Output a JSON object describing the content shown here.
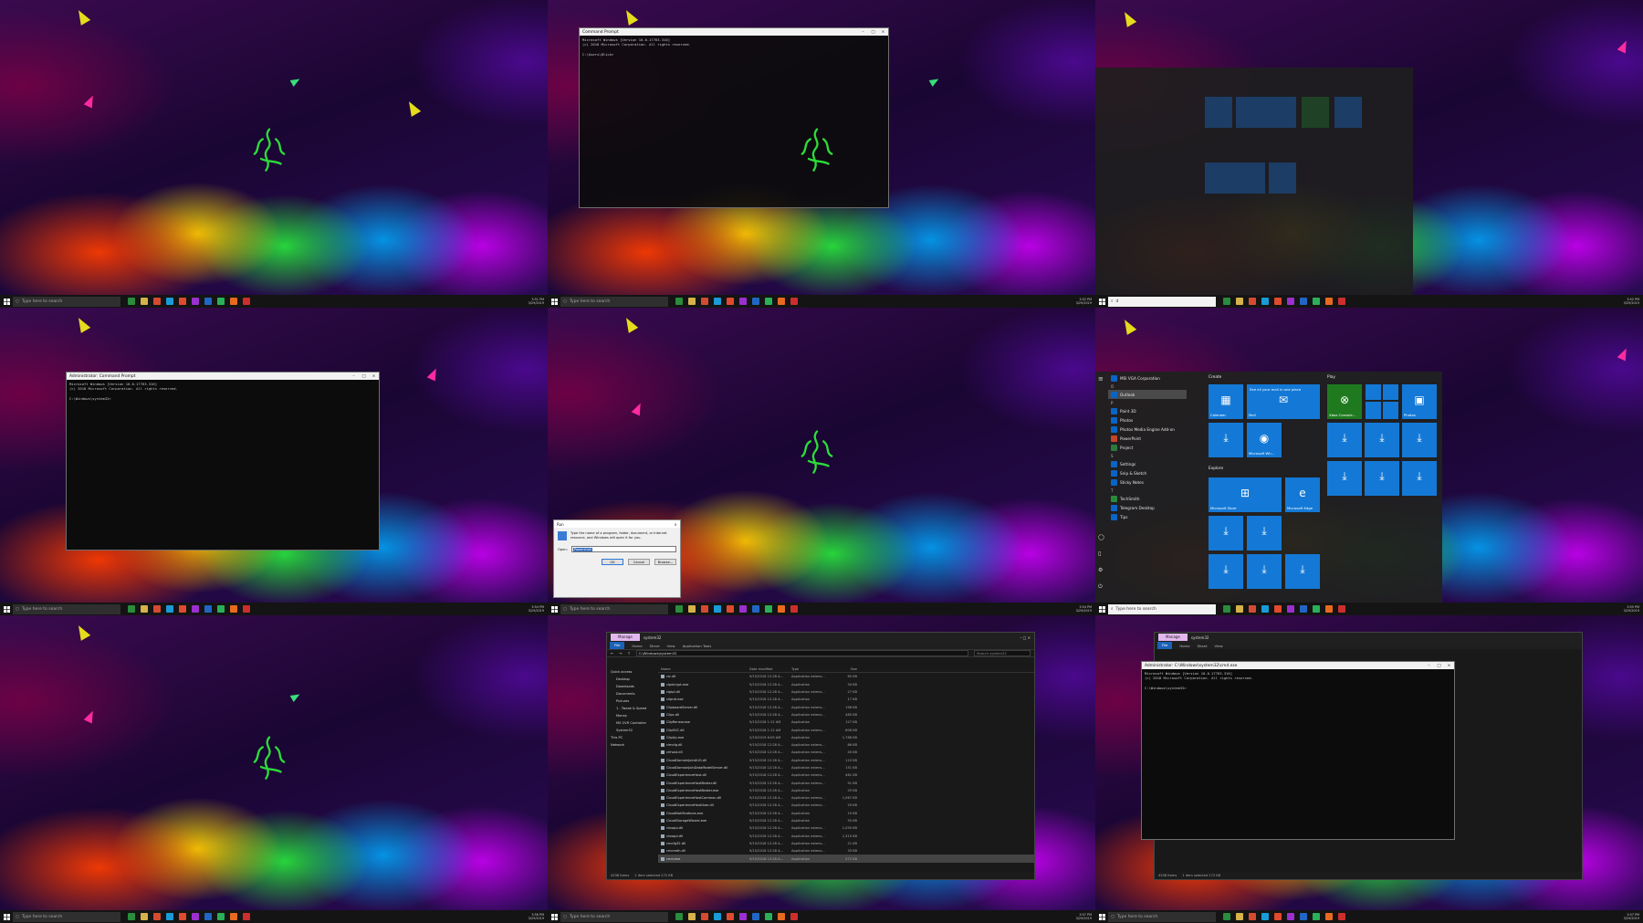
{
  "taskbar": {
    "search_placeholder": "Type here to search",
    "search_typed": "d",
    "app_colors": [
      "#2a8c3c",
      "#d6b24a",
      "#d54b32",
      "#1a9bd8",
      "#e04a2e",
      "#9c2fcf",
      "#2166c5",
      "#2bb05a",
      "#e86a1f",
      "#cc2e2e"
    ],
    "clock_times": [
      "3:51 PM",
      "3:52 PM",
      "3:52 PM",
      "3:54 PM",
      "3:54 PM",
      "3:55 PM",
      "3:56 PM",
      "3:57 PM",
      "3:57 PM"
    ],
    "clock_date": "3/29/2019"
  },
  "cmd_window": {
    "title": "Command Prompt",
    "line1": "Microsoft Windows [Version 10.0.17763.316]",
    "line2": "(c) 2018 Microsoft Corporation. All rights reserved.",
    "prompt": "C:\\Users\\Blick>"
  },
  "admin_cmd_window": {
    "title": "Administrator: Command Prompt",
    "line1": "Microsoft Windows [Version 10.0.17763.316]",
    "line2": "(c) 2018 Microsoft Corporation. All rights reserved.",
    "prompt": "C:\\Windows\\system32>"
  },
  "admin_cmd_exe_window": {
    "title": "Administrator: C:\\Windows\\system32\\cmd.exe",
    "line1": "Microsoft Windows [Version 10.0.17763.316]",
    "line2": "(c) 2018 Microsoft Corporation. All rights reserved.",
    "prompt": "C:\\Windows\\system32>"
  },
  "start_menu": {
    "top_items": [
      {
        "label": "MSI VGA Corporation",
        "sub": "New"
      },
      {
        "label": "Outlook",
        "sub": "New"
      },
      {
        "label": "Paint 3D",
        "sub": ""
      },
      {
        "label": "Photos",
        "sub": ""
      },
      {
        "label": "Photos Media Engine Add-on",
        "sub": ""
      },
      {
        "label": "PowerPoint",
        "sub": "New"
      },
      {
        "label": "Project",
        "sub": "New"
      }
    ],
    "letter_o": "O",
    "letter_p": "P",
    "letter_s": "S",
    "letter_t": "T",
    "s_items": [
      "Settings",
      "Snip & Sketch",
      "Sticky Notes"
    ],
    "t_items": [
      {
        "label": "TechSmith",
        "sub": "New"
      },
      {
        "label": "Telegram Desktop",
        "sub": "New"
      },
      {
        "label": "Tips",
        "sub": ""
      }
    ],
    "group_create": "Create",
    "group_play": "Play",
    "group_explore": "Explore",
    "tile_calendar": "Calendar",
    "tile_mail": "Mail",
    "tile_mail_caption": "See all your mail in one place",
    "tile_xbox": "Xbox Console...",
    "tile_photos": "Photos",
    "tile_ms": "Microsoft Wh...",
    "tile_store": "Microsoft Store",
    "tile_edge": "Microsoft Edge"
  },
  "run_dialog": {
    "title": "Run",
    "description": "Type the name of a program, folder, document, or Internet resource, and Windows will open it for you.",
    "open_label": "Open:",
    "open_value": "Powershell",
    "ok": "OK",
    "cancel": "Cancel",
    "browse": "Browse..."
  },
  "explorer": {
    "manage_tab": "Manage",
    "window_title": "system32",
    "ribbon_tabs": [
      "File",
      "Home",
      "Share",
      "View",
      "Application Tools"
    ],
    "address": "C:\\Windows\\system32",
    "search_placeholder": "Search system32",
    "nav_items": [
      "Quick access",
      "Desktop",
      "Downloads",
      "Documents",
      "Pictures",
      "1 - Tweak & Speed",
      "Money",
      "MS OVR Controller",
      "System32",
      "This PC",
      "Network"
    ],
    "columns": {
      "name": "Name",
      "date": "Date modified",
      "type": "Type",
      "size": "Size"
    },
    "rows": [
      {
        "name": "cic.dll",
        "date": "9/15/2018 12:28 A...",
        "type": "Application extens...",
        "size": "65 KB"
      },
      {
        "name": "cipdcrypt.exe",
        "date": "9/15/2018 12:28 A...",
        "type": "Application",
        "size": "34 KB"
      },
      {
        "name": "ciplpl.dll",
        "date": "9/15/2018 12:28 A...",
        "type": "Application extens...",
        "size": "27 KB"
      },
      {
        "name": "cliprdr.exe",
        "date": "9/15/2018 12:28 A...",
        "type": "Application",
        "size": "17 KB"
      },
      {
        "name": "ClipboardServer.dll",
        "date": "9/15/2018 12:28 A...",
        "type": "Application extens...",
        "size": "196 KB"
      },
      {
        "name": "Clipc.dll",
        "date": "9/15/2018 12:28 A...",
        "type": "Application extens...",
        "size": "485 KB"
      },
      {
        "name": "ClipRenew.exe",
        "date": "9/15/2018 1:12 AM",
        "type": "Application",
        "size": "127 KB"
      },
      {
        "name": "ClipSVC.dll",
        "date": "9/15/2018 1:12 AM",
        "type": "Application extens...",
        "size": "606 KB"
      },
      {
        "name": "ClipUp.exe",
        "date": "2/19/2019 6:09 AM",
        "type": "Application",
        "size": "1,786 KB"
      },
      {
        "name": "cimcfg.dll",
        "date": "9/15/2018 12:28 A...",
        "type": "Application extens...",
        "size": "66 KB"
      },
      {
        "name": "clrhost.dll",
        "date": "9/15/2018 12:28 A...",
        "type": "Application extens...",
        "size": "40 KB"
      },
      {
        "name": "CloudDomainJoinAUG.dll",
        "date": "9/15/2018 12:28 A...",
        "type": "Application extens...",
        "size": "110 KB"
      },
      {
        "name": "CloudDomainJoinDataModelServer.dll",
        "date": "9/15/2018 12:28 A...",
        "type": "Application extens...",
        "size": "151 KB"
      },
      {
        "name": "CloudExperienceHost.dll",
        "date": "9/15/2018 12:28 A...",
        "type": "Application extens...",
        "size": "461 KB"
      },
      {
        "name": "CloudExperienceHostBroker.dll",
        "date": "9/15/2018 12:28 A...",
        "type": "Application extens...",
        "size": "91 KB"
      },
      {
        "name": "CloudExperienceHostBroker.exe",
        "date": "9/15/2018 12:28 A...",
        "type": "Application",
        "size": "29 KB"
      },
      {
        "name": "CloudExperienceHostCommon.dll",
        "date": "9/15/2018 12:28 A...",
        "type": "Application extens...",
        "size": "1,067 KB"
      },
      {
        "name": "CloudExperienceHostUser.dll",
        "date": "9/15/2018 12:28 A...",
        "type": "Application extens...",
        "size": "29 KB"
      },
      {
        "name": "CloudNotifications.exe",
        "date": "9/15/2018 12:28 A...",
        "type": "Application",
        "size": "19 KB"
      },
      {
        "name": "CloudStorageWizard.exe",
        "date": "9/15/2018 12:28 A...",
        "type": "Application",
        "size": "55 KB"
      },
      {
        "name": "clusapi.dll",
        "date": "9/15/2018 12:28 A...",
        "type": "Application extens...",
        "size": "1,059 KB"
      },
      {
        "name": "clusapi.dll",
        "date": "9/15/2018 12:28 A...",
        "type": "Application extens...",
        "size": "1,310 KB"
      },
      {
        "name": "cmcfg32.dll",
        "date": "9/15/2018 12:28 A...",
        "type": "Application extens...",
        "size": "21 KB"
      },
      {
        "name": "cmcmdh.dll",
        "date": "9/15/2018 12:28 A...",
        "type": "Application extens...",
        "size": "33 KB"
      },
      {
        "name": "cmd.exe",
        "date": "9/15/2018 12:28 A...",
        "type": "Application",
        "size": "272 KB"
      }
    ],
    "status_count": "4338 items",
    "status_selected": "1 item selected  272 KB"
  }
}
